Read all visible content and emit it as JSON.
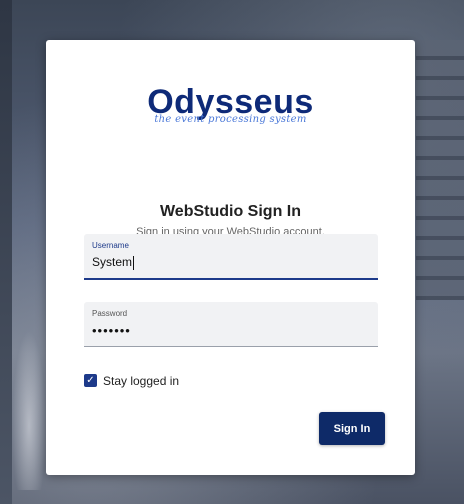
{
  "brand": {
    "name": "Odysseus",
    "tagline": "the event processing system",
    "color": "#0e2a78",
    "tagline_color": "#4a78d8"
  },
  "signin": {
    "title": "WebStudio Sign In",
    "subtitle": "Sign in using your WebStudio account."
  },
  "username": {
    "label": "Username",
    "value": "System"
  },
  "password": {
    "label": "Password",
    "value": "•••••••"
  },
  "stay_logged_in": {
    "label": "Stay logged in",
    "checked": true,
    "check_glyph": "✓"
  },
  "submit": {
    "label": "Sign In",
    "color": "#0e2a68"
  }
}
